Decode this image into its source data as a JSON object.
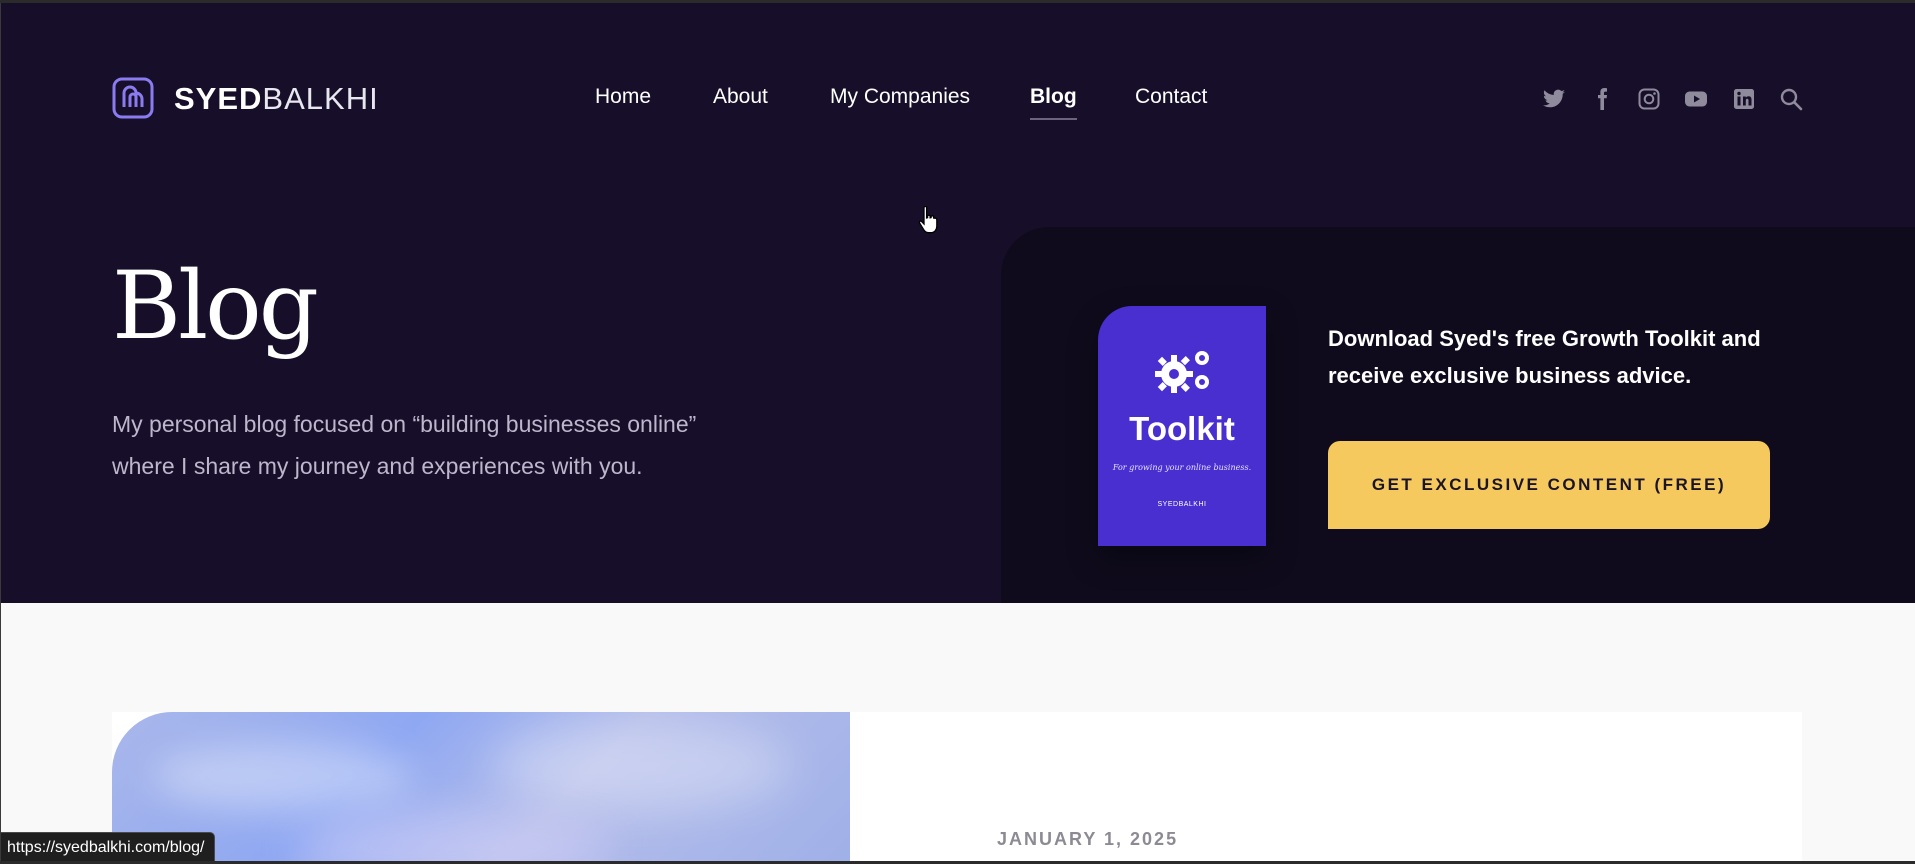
{
  "brand": {
    "name_bold": "SYED",
    "name_light": "BALKHI",
    "mark": "syedbalkhi-logo-icon",
    "mark_color": "#8b7bf0"
  },
  "nav": {
    "items": [
      {
        "label": "Home",
        "active": false
      },
      {
        "label": "About",
        "active": false
      },
      {
        "label": "My Companies",
        "active": false
      },
      {
        "label": "Blog",
        "active": true
      },
      {
        "label": "Contact",
        "active": false
      }
    ]
  },
  "social": {
    "icons": [
      "twitter-icon",
      "facebook-icon",
      "instagram-icon",
      "youtube-icon",
      "linkedin-icon",
      "search-icon"
    ],
    "color": "#8f8a9c"
  },
  "hero": {
    "title": "Blog",
    "subtitle_line1": "My personal blog focused on “building businesses online”",
    "subtitle_line2": "where I share my journey and experiences with you.",
    "background": "#170f2a"
  },
  "promo": {
    "book": {
      "title": "Toolkit",
      "tagline": "For growing your online business.",
      "brand": "SYEDBALKHI",
      "color": "#4a2fd0",
      "icon": "gears-icon"
    },
    "text_line1": "Download Syed's free Growth Toolkit and",
    "text_line2": "receive exclusive business advice.",
    "cta_label": "GET EXCLUSIVE CONTENT (FREE)",
    "cta_color": "#f5c95e"
  },
  "post": {
    "date": "JANUARY 1, 2025"
  },
  "status_bar": {
    "url": "https://syedbalkhi.com/blog/"
  }
}
